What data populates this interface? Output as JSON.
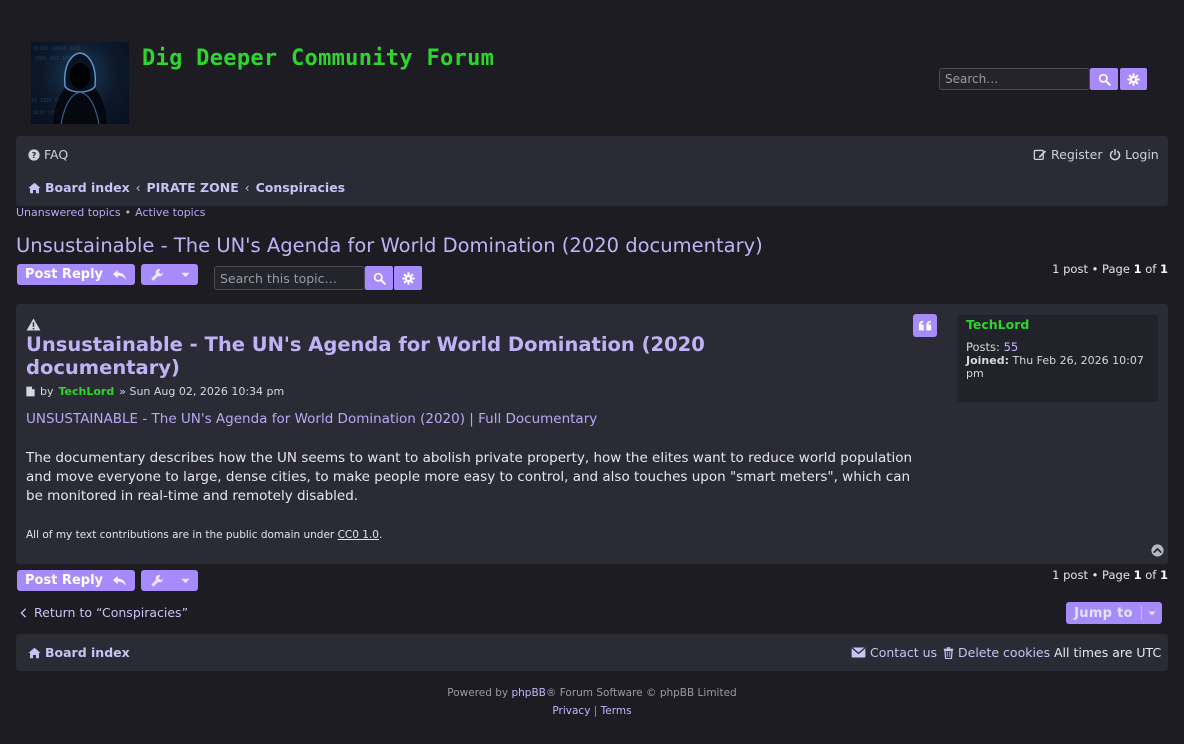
{
  "site": {
    "title": "Dig Deeper Community Forum",
    "search_placeholder": "Search…"
  },
  "nav": {
    "faq": "FAQ",
    "register": "Register",
    "login": "Login",
    "breadcrumbs": [
      "Board index",
      "PIRATE ZONE",
      "Conspiracies"
    ]
  },
  "quick_links": {
    "unanswered": "Unanswered topics",
    "separator": "•",
    "active": "Active topics"
  },
  "topic": {
    "title": "Unsustainable - The UN's Agenda for World Domination (2020 documentary)",
    "post_reply": "Post Reply",
    "search_placeholder": "Search this topic…",
    "pagination": {
      "prefix": "1 post • Page ",
      "page": "1",
      "of": " of ",
      "total": "1"
    }
  },
  "post": {
    "title": "Unsustainable - The UN's Agenda for World Domination (2020 documentary)",
    "by": "by",
    "author": "TechLord",
    "date": "» Sun Aug 02, 2026 10:34 pm",
    "link_text": "UNSUSTAINABLE - The UN's Agenda for World Domination (2020) | Full Documentary",
    "body": "The documentary describes how the UN seems to want to abolish private property, how the elites want to reduce world population and move everyone to large, dense cities, to make people more easy to control, and also touches upon \"smart meters\", which can be monitored in real-time and remotely disabled.",
    "signature_prefix": "All of my text contributions are in the public domain under ",
    "signature_link": "CC0 1.0",
    "signature_suffix": "."
  },
  "profile": {
    "username": "TechLord",
    "posts_label": "Posts:",
    "posts_value": "55",
    "joined_label": "Joined:",
    "joined_value": "Thu Feb 26, 2026 10:07 pm"
  },
  "bottom": {
    "return_link": "Return to “Conspiracies”",
    "jump_to": "Jump to"
  },
  "footer": {
    "board_index": "Board index",
    "contact": "Contact us",
    "delete_cookies": "Delete cookies",
    "timezone": "All times are UTC",
    "powered_prefix": "Powered by ",
    "powered_link": "phpBB",
    "powered_suffix": "® Forum Software © phpBB Limited",
    "privacy": "Privacy",
    "divider": "|",
    "terms": "Terms"
  },
  "colors": {
    "background": "#1c1c22",
    "panel": "#2b2b35",
    "accent": "#a78bfa",
    "link": "#c4b5fd",
    "title_green": "#2ed52e"
  },
  "icons": [
    "hooded-figure-logo",
    "search-icon",
    "gear-icon",
    "question-circle-icon",
    "edit-icon",
    "power-icon",
    "home-icon",
    "reply-icon",
    "wrench-icon",
    "caret-down-icon",
    "warning-icon",
    "quote-icon",
    "file-icon",
    "back-to-top-icon",
    "chevron-left-icon",
    "envelope-icon",
    "trash-icon"
  ]
}
